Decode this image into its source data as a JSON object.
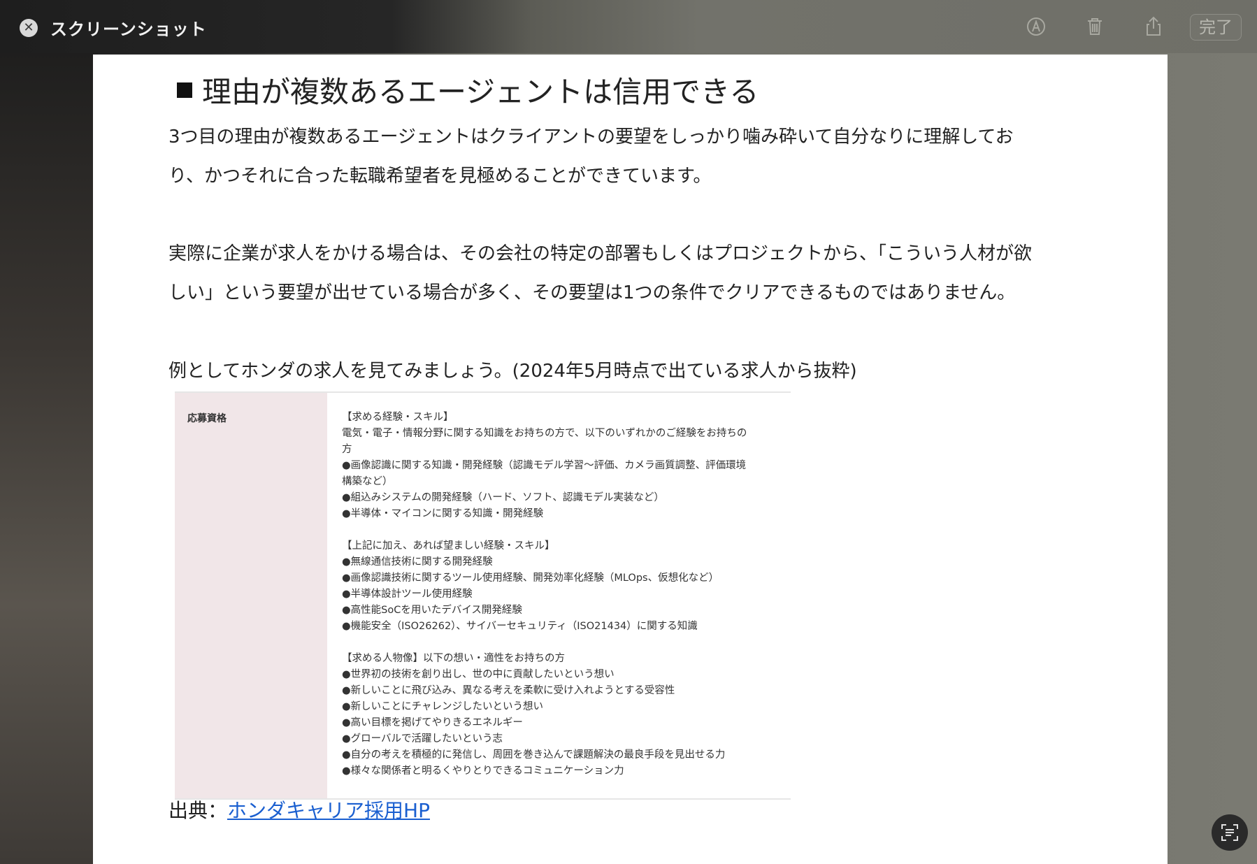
{
  "window": {
    "title": "スクリーンショット",
    "done_label": "完了",
    "icons": [
      "close-icon",
      "markup-icon",
      "trash-icon",
      "share-icon",
      "live-text-icon"
    ]
  },
  "article": {
    "heading": "理由が複数あるエージェントは信用できる",
    "para1_line1": "3つ目の理由が複数あるエージェントはクライアントの要望をしっかり噛み砕いて自分なりに理解してお",
    "para1_line2": "り、かつそれに合った転職希望者を見極めることができています。",
    "para2_line1": "実際に企業が求人をかける場合は、その会社の特定の部署もしくはプロジェクトから、「こういう人材が欲",
    "para2_line2": "しい」という要望が出せている場合が多く、その要望は1つの条件でクリアできるものではありません。",
    "para3": "例としてホンダの求人を見てみましょう。(2024年5月時点で出ている求人から抜粋)",
    "source_prefix": "出典：",
    "source_link": "ホンダキャリア採用HP"
  },
  "job_table": {
    "label": "応募資格",
    "lines": [
      "【求める経験・スキル】",
      "電気・電子・情報分野に関する知識をお持ちの方で、以下のいずれかのご経験をお持ちの",
      "方",
      "●画像認識に関する知識・開発経験（認識モデル学習〜評価、カメラ画質調整、評価環境",
      "構築など）",
      "●組込みシステムの開発経験（ハード、ソフト、認識モデル実装など）",
      "●半導体・マイコンに関する知識・開発経験",
      "",
      "【上記に加え、あれば望ましい経験・スキル】",
      "●無線通信技術に関する開発経験",
      "●画像認識技術に関するツール使用経験、開発効率化経験（MLOps、仮想化など）",
      "●半導体設計ツール使用経験",
      "●高性能SoCを用いたデバイス開発経験",
      "●機能安全（ISO26262）、サイバーセキュリティ（ISO21434）に関する知識",
      "",
      "【求める人物像】以下の想い・適性をお持ちの方",
      "●世界初の技術を創り出し、世の中に貢献したいという想い",
      "●新しいことに飛び込み、異なる考えを柔軟に受け入れようとする受容性",
      "●新しいことにチャレンジしたいという想い",
      "●高い目標を掲げてやりきるエネルギー",
      "●グローバルで活躍したいという志",
      "●自分の考えを積極的に発信し、周囲を巻き込んで課題解決の最良手段を見出せる力",
      "●様々な関係者と明るくやりとりできるコミュニケーション力"
    ]
  }
}
